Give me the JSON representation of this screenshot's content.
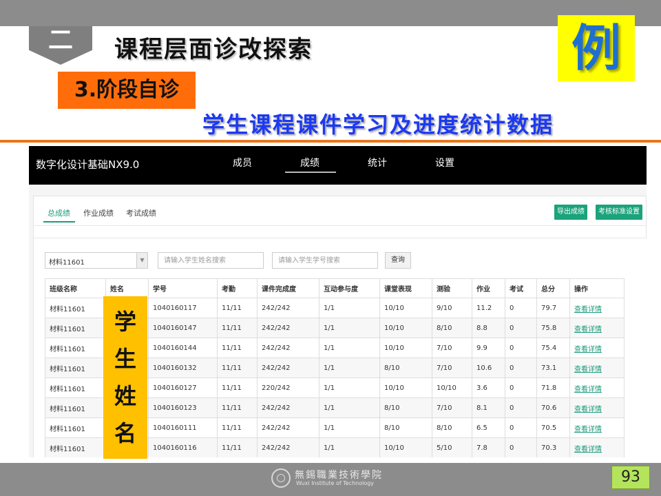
{
  "slide": {
    "section_number": "二",
    "title": "课程层面诊改探索",
    "example_badge": "例",
    "stage_label": "3.阶段自诊",
    "subtitle": "学生课程课件学习及进度统计数据",
    "page_number": "93",
    "school_name_cn": "無錫職業技術學院",
    "school_name_en": "Wuxi Institute of Technology",
    "overlay_chars": [
      "学",
      "生",
      "姓",
      "名"
    ],
    "colors": {
      "stage_label_bg": "#ff6d0a",
      "subtitle_text": "#1c39f2",
      "example_badge_bg": "#ffff00",
      "example_badge_text": "#1f6fd1",
      "overlay_bg": "#ffc000",
      "accent_green": "#1ba37b"
    }
  },
  "app": {
    "course_name": "数字化设计基础NX9.0",
    "nav_tabs": [
      "成员",
      "成绩",
      "统计",
      "设置"
    ],
    "active_nav_tab": "成绩",
    "sub_tabs": [
      "总成绩",
      "作业成绩",
      "考试成绩"
    ],
    "active_sub_tab": "总成绩",
    "export_button": "导出成绩",
    "standard_button": "考核标准设置",
    "class_select_value": "材料11601",
    "name_search_placeholder": "请输入学生姓名搜索",
    "id_search_placeholder": "请输入学生学号搜索",
    "query_button": "查询",
    "table": {
      "headers": [
        "班级名称",
        "姓名",
        "学号",
        "考勤",
        "课件完成度",
        "互动参与度",
        "课堂表现",
        "测验",
        "作业",
        "考试",
        "总分",
        "操作"
      ],
      "rows": [
        [
          "材料11601",
          "",
          "1040160117",
          "11/11",
          "242/242",
          "1/1",
          "10/10",
          "9/10",
          "11.2",
          "0",
          "79.7",
          "查看详情"
        ],
        [
          "材料11601",
          "",
          "1040160147",
          "11/11",
          "242/242",
          "1/1",
          "10/10",
          "8/10",
          "8.8",
          "0",
          "75.8",
          "查看详情"
        ],
        [
          "材料11601",
          "",
          "1040160144",
          "11/11",
          "242/242",
          "1/1",
          "10/10",
          "7/10",
          "9.9",
          "0",
          "75.4",
          "查看详情"
        ],
        [
          "材料11601",
          "",
          "1040160132",
          "11/11",
          "242/242",
          "1/1",
          "8/10",
          "7/10",
          "10.6",
          "0",
          "73.1",
          "查看详情"
        ],
        [
          "材料11601",
          "",
          "1040160127",
          "11/11",
          "220/242",
          "1/1",
          "10/10",
          "10/10",
          "3.6",
          "0",
          "71.8",
          "查看详情"
        ],
        [
          "材料11601",
          "",
          "1040160123",
          "11/11",
          "242/242",
          "1/1",
          "8/10",
          "7/10",
          "8.1",
          "0",
          "70.6",
          "查看详情"
        ],
        [
          "材料11601",
          "",
          "1040160111",
          "11/11",
          "242/242",
          "1/1",
          "8/10",
          "8/10",
          "6.5",
          "0",
          "70.5",
          "查看详情"
        ],
        [
          "材料11601",
          "",
          "1040160116",
          "11/11",
          "242/242",
          "1/1",
          "10/10",
          "5/10",
          "7.8",
          "0",
          "70.3",
          "查看详情"
        ],
        [
          "",
          "",
          "",
          "",
          "",
          "",
          "",
          "",
          "",
          "",
          "",
          ""
        ]
      ]
    }
  }
}
